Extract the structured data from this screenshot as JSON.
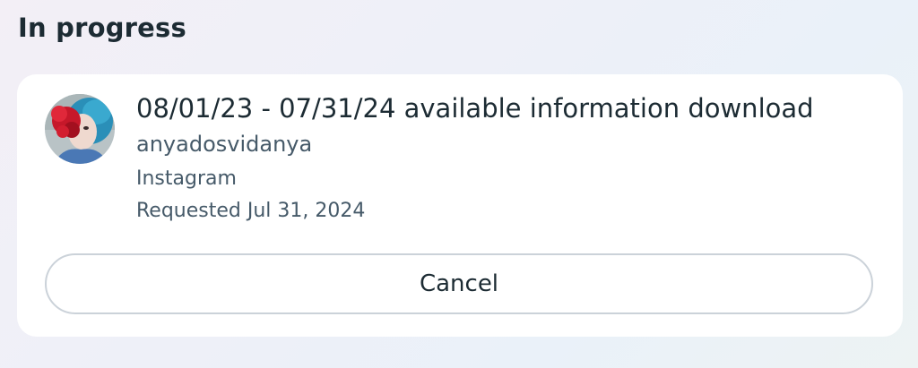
{
  "section": {
    "title": "In progress"
  },
  "request": {
    "title": "08/01/23 - 07/31/24 available information download",
    "username": "anyadosvidanya",
    "platform": "Instagram",
    "requested": "Requested Jul 31, 2024",
    "avatar_icon": "profile-photo-icon",
    "cancel_label": "Cancel"
  }
}
